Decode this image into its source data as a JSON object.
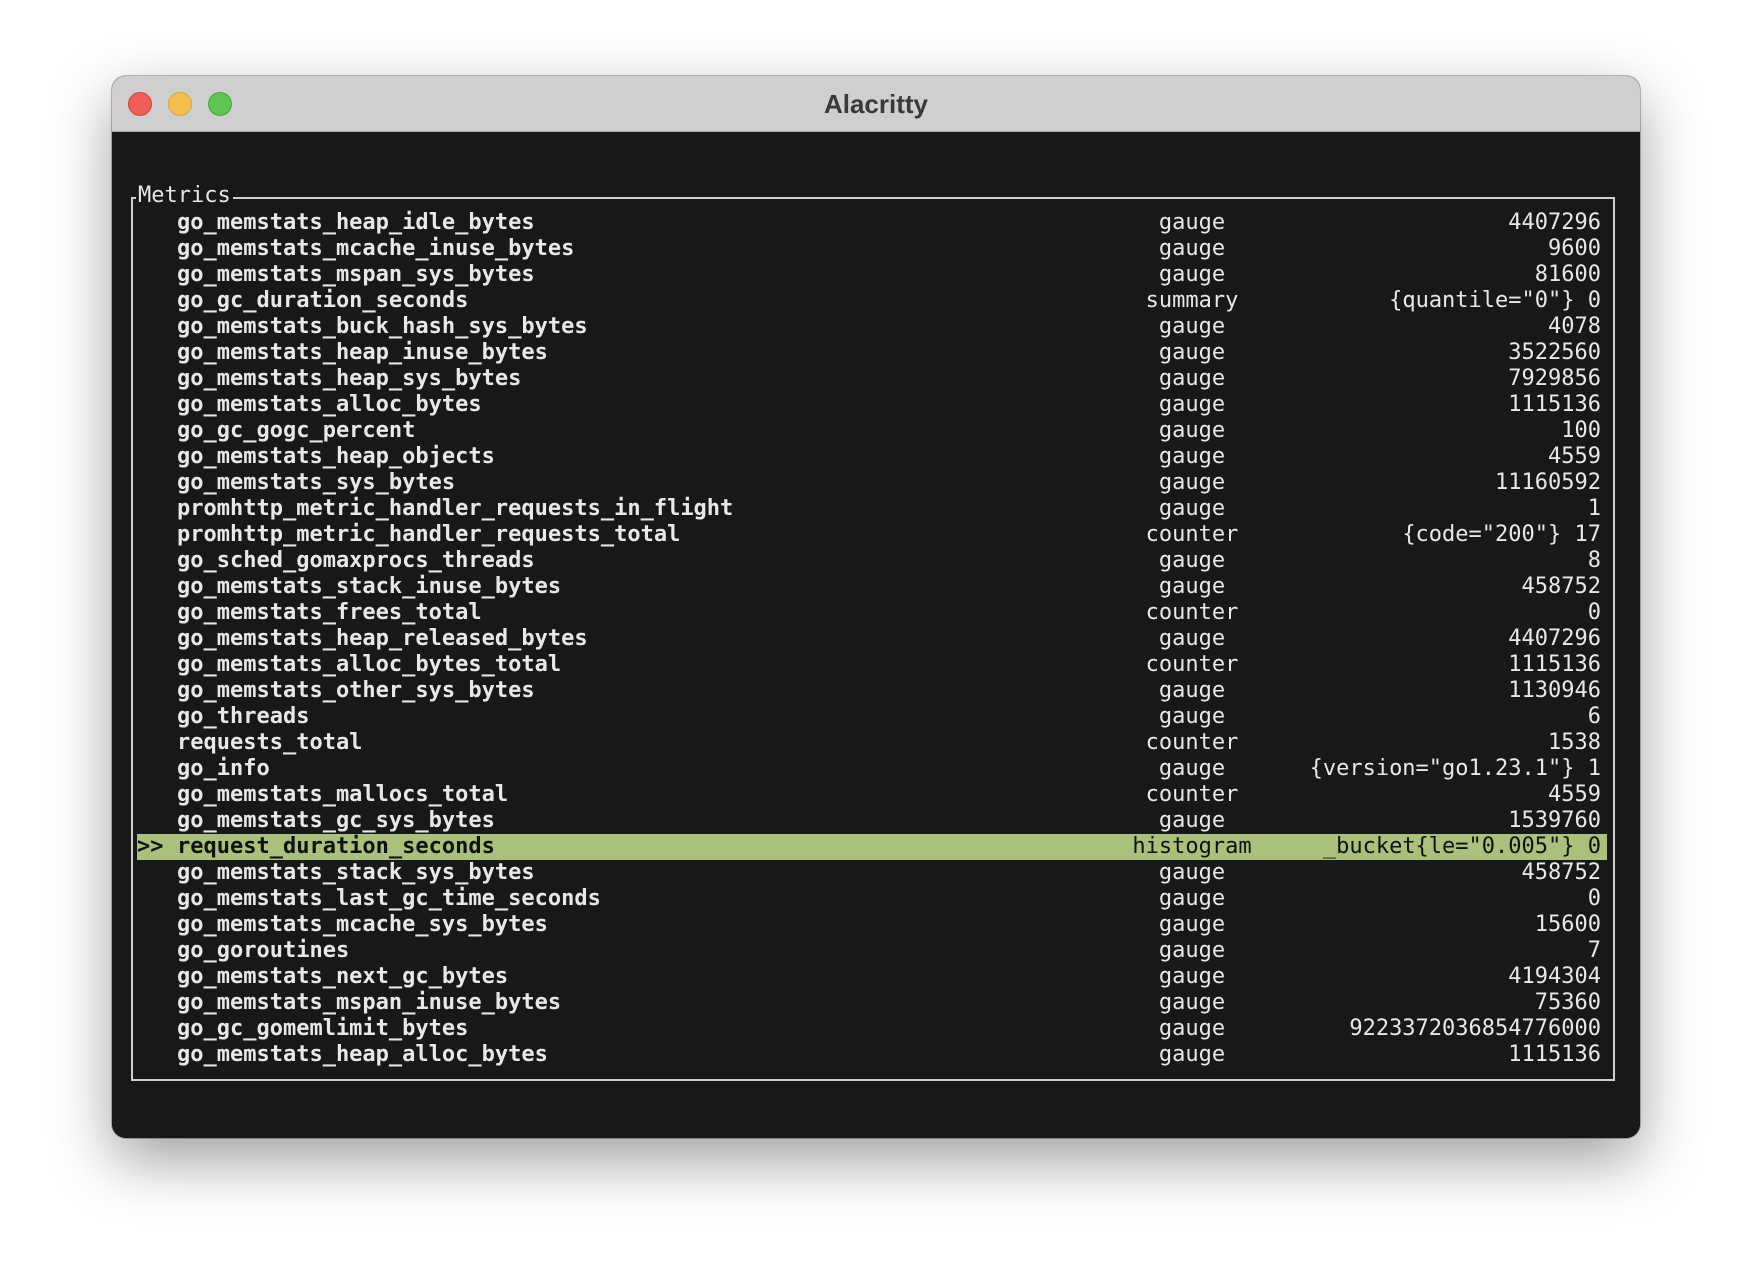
{
  "window": {
    "title": "Alacritty"
  },
  "panel": {
    "title": "Metrics"
  },
  "selection_marker": ">>",
  "colors": {
    "terminal_bg": "#181818",
    "selected_row_bg": "#a9c17a",
    "close": "#ee5f57",
    "minimize": "#f5bf4f",
    "maximize": "#5fc454"
  },
  "metrics": [
    {
      "name": "go_memstats_heap_idle_bytes",
      "type": "gauge",
      "value": "4407296"
    },
    {
      "name": "go_memstats_mcache_inuse_bytes",
      "type": "gauge",
      "value": "9600"
    },
    {
      "name": "go_memstats_mspan_sys_bytes",
      "type": "gauge",
      "value": "81600"
    },
    {
      "name": "go_gc_duration_seconds",
      "type": "summary",
      "value": "{quantile=\"0\"} 0"
    },
    {
      "name": "go_memstats_buck_hash_sys_bytes",
      "type": "gauge",
      "value": "4078"
    },
    {
      "name": "go_memstats_heap_inuse_bytes",
      "type": "gauge",
      "value": "3522560"
    },
    {
      "name": "go_memstats_heap_sys_bytes",
      "type": "gauge",
      "value": "7929856"
    },
    {
      "name": "go_memstats_alloc_bytes",
      "type": "gauge",
      "value": "1115136"
    },
    {
      "name": "go_gc_gogc_percent",
      "type": "gauge",
      "value": "100"
    },
    {
      "name": "go_memstats_heap_objects",
      "type": "gauge",
      "value": "4559"
    },
    {
      "name": "go_memstats_sys_bytes",
      "type": "gauge",
      "value": "11160592"
    },
    {
      "name": "promhttp_metric_handler_requests_in_flight",
      "type": "gauge",
      "value": "1"
    },
    {
      "name": "promhttp_metric_handler_requests_total",
      "type": "counter",
      "value": "{code=\"200\"} 17"
    },
    {
      "name": "go_sched_gomaxprocs_threads",
      "type": "gauge",
      "value": "8"
    },
    {
      "name": "go_memstats_stack_inuse_bytes",
      "type": "gauge",
      "value": "458752"
    },
    {
      "name": "go_memstats_frees_total",
      "type": "counter",
      "value": "0"
    },
    {
      "name": "go_memstats_heap_released_bytes",
      "type": "gauge",
      "value": "4407296"
    },
    {
      "name": "go_memstats_alloc_bytes_total",
      "type": "counter",
      "value": "1115136"
    },
    {
      "name": "go_memstats_other_sys_bytes",
      "type": "gauge",
      "value": "1130946"
    },
    {
      "name": "go_threads",
      "type": "gauge",
      "value": "6"
    },
    {
      "name": "requests_total",
      "type": "counter",
      "value": "1538"
    },
    {
      "name": "go_info",
      "type": "gauge",
      "value": "{version=\"go1.23.1\"} 1"
    },
    {
      "name": "go_memstats_mallocs_total",
      "type": "counter",
      "value": "4559"
    },
    {
      "name": "go_memstats_gc_sys_bytes",
      "type": "gauge",
      "value": "1539760"
    },
    {
      "name": "request_duration_seconds",
      "type": "histogram",
      "value": "_bucket{le=\"0.005\"} 0",
      "selected": true
    },
    {
      "name": "go_memstats_stack_sys_bytes",
      "type": "gauge",
      "value": "458752"
    },
    {
      "name": "go_memstats_last_gc_time_seconds",
      "type": "gauge",
      "value": "0"
    },
    {
      "name": "go_memstats_mcache_sys_bytes",
      "type": "gauge",
      "value": "15600"
    },
    {
      "name": "go_goroutines",
      "type": "gauge",
      "value": "7"
    },
    {
      "name": "go_memstats_next_gc_bytes",
      "type": "gauge",
      "value": "4194304"
    },
    {
      "name": "go_memstats_mspan_inuse_bytes",
      "type": "gauge",
      "value": "75360"
    },
    {
      "name": "go_gc_gomemlimit_bytes",
      "type": "gauge",
      "value": "9223372036854776000"
    },
    {
      "name": "go_memstats_heap_alloc_bytes",
      "type": "gauge",
      "value": "1115136"
    }
  ]
}
